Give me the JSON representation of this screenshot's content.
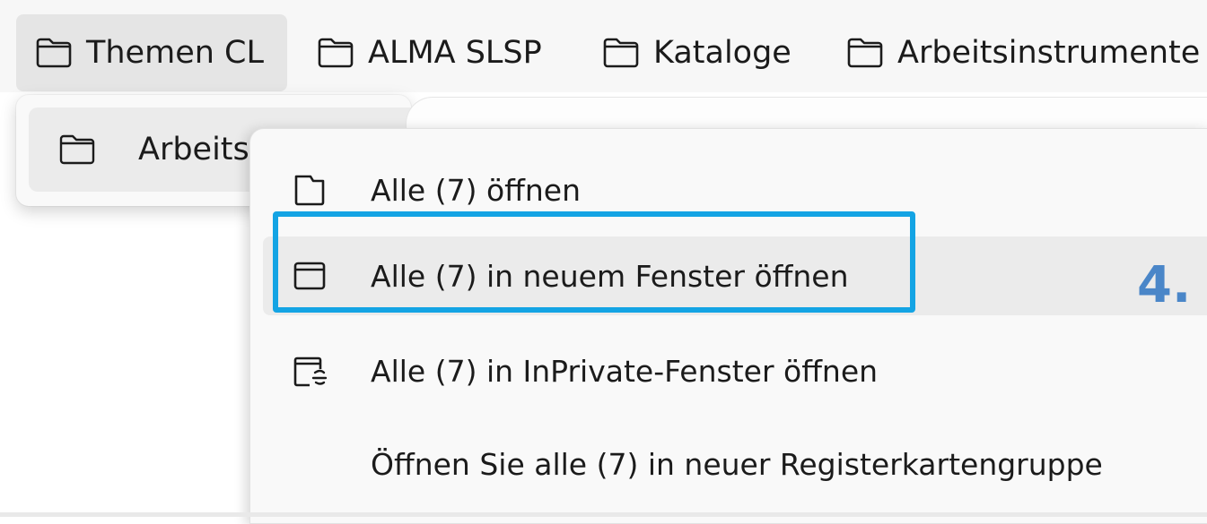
{
  "bookmarks_bar": {
    "items": [
      {
        "label": "Themen CL",
        "icon": "folder-icon",
        "active": true
      },
      {
        "label": "ALMA SLSP",
        "icon": "folder-icon",
        "active": false
      },
      {
        "label": "Kataloge",
        "icon": "folder-icon",
        "active": false
      },
      {
        "label": "Arbeitsinstrumente",
        "icon": "folder-icon",
        "active": false
      }
    ]
  },
  "submenu": {
    "item_label": "Arbeits",
    "item_icon": "folder-icon"
  },
  "context_menu": {
    "items": [
      {
        "label": "Alle (7) öffnen",
        "icon": "tab-icon"
      },
      {
        "label": "Alle (7) in neuem Fenster öffnen",
        "icon": "window-icon"
      },
      {
        "label": "Alle (7) in InPrivate-Fenster öffnen",
        "icon": "inprivate-window-icon"
      },
      {
        "label": "Öffnen Sie alle (7) in neuer Registerkartengruppe",
        "icon": ""
      }
    ]
  },
  "annotation": {
    "step_label": "4.",
    "highlight_color": "#14a4e4",
    "step_color": "#4a86c8"
  }
}
